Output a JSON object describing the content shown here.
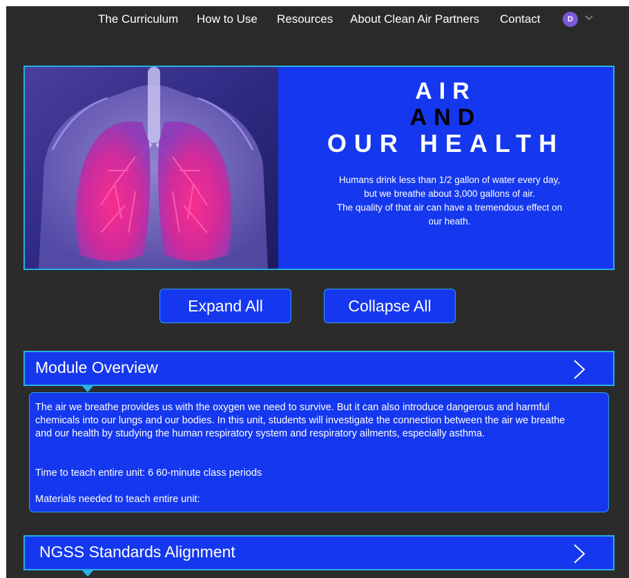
{
  "nav": {
    "items": [
      "The Curriculum",
      "How to Use",
      "Resources",
      "About Clean Air Partners",
      "Contact"
    ],
    "avatar_initial": "D"
  },
  "hero": {
    "title_line1": "AIR",
    "title_line2": "AND",
    "title_line3": "OUR HEALTH",
    "text_lines": [
      "Humans drink less than 1/2 gallon of water every day,",
      "but we breathe about 3,000 gallons of air.",
      "The quality of that air can have a tremendous effect on",
      "our heath."
    ]
  },
  "buttons": {
    "expand": "Expand All",
    "collapse": "Collapse All"
  },
  "sections": [
    {
      "title": "Module Overview",
      "body": [
        "The air we breathe provides us with the oxygen we need to survive. But it can also introduce dangerous and harmful chemicals into our lungs and our bodies. In this unit, students will investigate the connection between the air we breathe and our health by studying the human respiratory system and respiratory ailments, especially asthma.",
        "Time to teach entire unit: 6 60-minute class periods",
        "Materials needed to teach entire unit:"
      ]
    },
    {
      "title": "NGSS Standards Alignment"
    }
  ],
  "colors": {
    "accent_blue": "#1538ee",
    "border_cyan": "#27b1e6",
    "page_bg": "#2b2b2b",
    "avatar": "#7b59d6"
  }
}
